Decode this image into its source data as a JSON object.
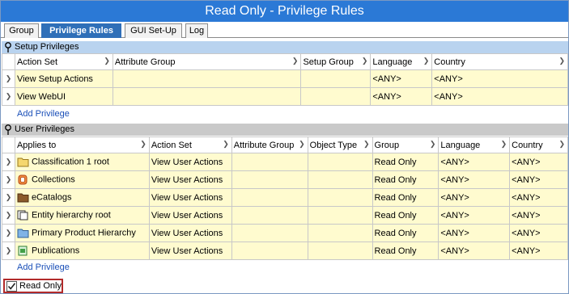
{
  "window": {
    "title": "Read Only - Privilege Rules"
  },
  "tabs": [
    {
      "label": "Group"
    },
    {
      "label": "Privilege Rules"
    },
    {
      "label": "GUI Set-Up"
    },
    {
      "label": "Log"
    }
  ],
  "setup": {
    "title": "Setup Privileges",
    "columns": [
      "Action Set",
      "Attribute Group",
      "Setup Group",
      "Language",
      "Country"
    ],
    "rows": [
      {
        "action_set": "View Setup Actions",
        "attribute_group": "",
        "setup_group": "",
        "language": "<ANY>",
        "country": "<ANY>"
      },
      {
        "action_set": "View WebUI",
        "attribute_group": "",
        "setup_group": "",
        "language": "<ANY>",
        "country": "<ANY>"
      }
    ],
    "add_label": "Add Privilege"
  },
  "user": {
    "title": "User Privileges",
    "columns": [
      "Applies to",
      "Action Set",
      "Attribute Group",
      "Object Type",
      "Group",
      "Language",
      "Country"
    ],
    "rows": [
      {
        "applies_to": "Classification 1 root",
        "icon": "folder-icon",
        "action_set": "View User Actions",
        "attribute_group": "",
        "object_type": "",
        "group": "Read Only",
        "language": "<ANY>",
        "country": "<ANY>"
      },
      {
        "applies_to": "Collections",
        "icon": "collections-icon",
        "action_set": "View User Actions",
        "attribute_group": "",
        "object_type": "",
        "group": "Read Only",
        "language": "<ANY>",
        "country": "<ANY>"
      },
      {
        "applies_to": "eCatalogs",
        "icon": "catalog-folder-icon",
        "action_set": "View User Actions",
        "attribute_group": "",
        "object_type": "",
        "group": "Read Only",
        "language": "<ANY>",
        "country": "<ANY>"
      },
      {
        "applies_to": "Entity hierarchy root",
        "icon": "entity-hierarchy-icon",
        "action_set": "View User Actions",
        "attribute_group": "",
        "object_type": "",
        "group": "Read Only",
        "language": "<ANY>",
        "country": "<ANY>"
      },
      {
        "applies_to": "Primary Product Hierarchy",
        "icon": "product-folder-icon",
        "action_set": "View User Actions",
        "attribute_group": "",
        "object_type": "",
        "group": "Read Only",
        "language": "<ANY>",
        "country": "<ANY>"
      },
      {
        "applies_to": "Publications",
        "icon": "publications-icon",
        "action_set": "View User Actions",
        "attribute_group": "",
        "object_type": "",
        "group": "Read Only",
        "language": "<ANY>",
        "country": "<ANY>"
      }
    ],
    "add_label": "Add Privilege"
  },
  "read_only": {
    "label": "Read Only",
    "checked": true
  },
  "colors": {
    "titlebar": "#2b79d6",
    "active_tab": "#2f6fb8",
    "row_fill": "#fffbcf",
    "link": "#1a4fb8",
    "highlight_border": "#b22a2a"
  }
}
